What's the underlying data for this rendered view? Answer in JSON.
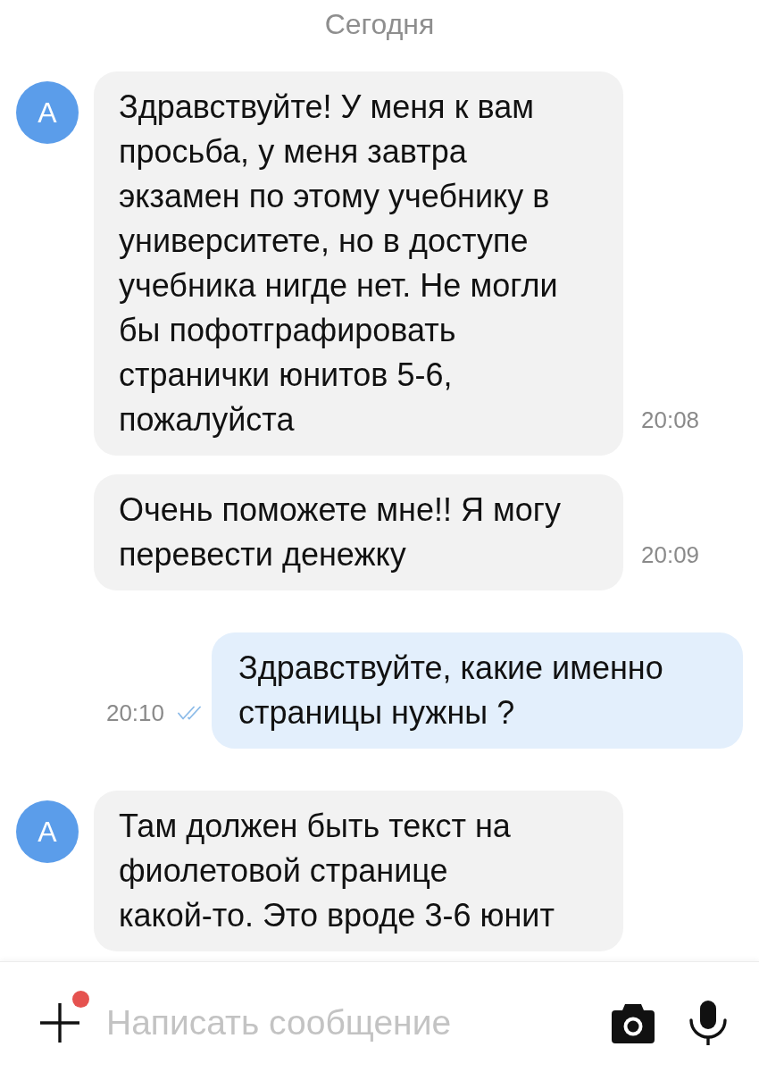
{
  "date_divider": "Сегодня",
  "messages": [
    {
      "kind": "incoming",
      "avatar": "А",
      "text": "Здравствуйте! У меня к вам просьба, у меня завтра экзамен по этому учебнику в университете, но в доступе учебника нигде нет. Не могли бы пофотграфировать странички юнитов 5-6, пожалуйста",
      "time": "20:08"
    },
    {
      "kind": "incoming",
      "text": "Очень поможете мне!! Я могу перевести денежку",
      "time": "20:09"
    },
    {
      "kind": "outgoing",
      "text": "Здравствуйте, какие именно страницы нужны ?",
      "time": "20:10",
      "read": true
    },
    {
      "kind": "incoming",
      "avatar": "А",
      "text": "Там должен быть текст на фиолетовой странице какой-то. Это вроде 3-6 юнит"
    }
  ],
  "composer": {
    "placeholder": "Написать сообщение",
    "attachment_badge": true
  }
}
